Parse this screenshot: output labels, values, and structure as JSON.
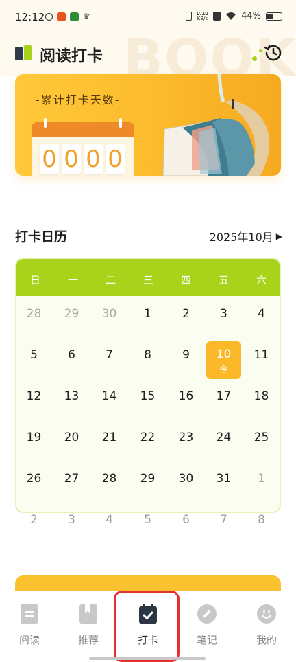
{
  "status_bar": {
    "time": "12:12",
    "speed_top": "0.10",
    "speed_bottom": "KB/s",
    "battery": "44%"
  },
  "header": {
    "title": "阅读打卡",
    "watermark": "BOOK",
    "logo_icon": "book-icon",
    "history_icon": "history-clock-icon"
  },
  "banner": {
    "label": "-累计打卡天数-",
    "digits": [
      "0",
      "0",
      "0",
      "0"
    ]
  },
  "calendar": {
    "title": "打卡日历",
    "month": "2025年10月",
    "month_next_icon": "triangle-right-icon",
    "weekdays": [
      "日",
      "一",
      "二",
      "三",
      "四",
      "五",
      "六"
    ],
    "rows": [
      [
        "28",
        "29",
        "30",
        "1",
        "2",
        "3",
        "4"
      ],
      [
        "5",
        "6",
        "7",
        "8",
        "9",
        "10",
        "11"
      ],
      [
        "12",
        "13",
        "14",
        "15",
        "16",
        "17",
        "18"
      ],
      [
        "19",
        "20",
        "21",
        "22",
        "23",
        "24",
        "25"
      ],
      [
        "26",
        "27",
        "28",
        "29",
        "30",
        "31",
        "1"
      ]
    ],
    "after_row": [
      "2",
      "3",
      "4",
      "5",
      "6",
      "7",
      "8"
    ],
    "today": {
      "day": "10",
      "label": "今"
    }
  },
  "bottom_nav": {
    "items": [
      {
        "label": "阅读",
        "icon": "read-icon",
        "active": false
      },
      {
        "label": "推荐",
        "icon": "recommend-icon",
        "active": false
      },
      {
        "label": "打卡",
        "icon": "calendar-check-icon",
        "active": true
      },
      {
        "label": "笔记",
        "icon": "pencil-icon",
        "active": false
      },
      {
        "label": "我的",
        "icon": "profile-icon",
        "active": false
      }
    ]
  },
  "colors": {
    "accent_green": "#a9d31a",
    "accent_yellow": "#fbb92a",
    "highlight_red": "#e53030"
  }
}
